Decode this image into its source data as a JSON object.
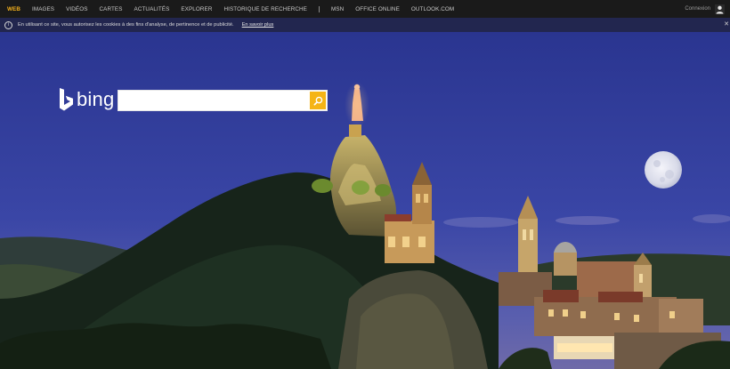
{
  "nav": {
    "items": [
      {
        "label": "WEB",
        "active": true
      },
      {
        "label": "IMAGES"
      },
      {
        "label": "VIDÉOS"
      },
      {
        "label": "CARTES"
      },
      {
        "label": "ACTUALITÉS"
      },
      {
        "label": "EXPLORER"
      },
      {
        "label": "HISTORIQUE DE RECHERCHE"
      },
      {
        "label": "MSN"
      },
      {
        "label": "OFFICE ONLINE"
      },
      {
        "label": "OUTLOOK.COM"
      }
    ],
    "signin_label": "Connexion",
    "icons": {
      "user": "user-icon"
    }
  },
  "cookie_bar": {
    "text": "En utilisant ce site, vous autorisez les cookies à des fins d'analyse, de pertinence et de publicité.",
    "link_label": "En savoir plus",
    "icons": {
      "info": "info-icon",
      "close": "close-icon"
    }
  },
  "logo": {
    "text": "bing"
  },
  "search": {
    "value": "",
    "placeholder": "",
    "icon": "search-icon"
  },
  "colors": {
    "accent": "#f3b01c",
    "nav_bg": "#1a1a1a",
    "cookie_bg": "#22264f",
    "sky": "#2c3690"
  }
}
